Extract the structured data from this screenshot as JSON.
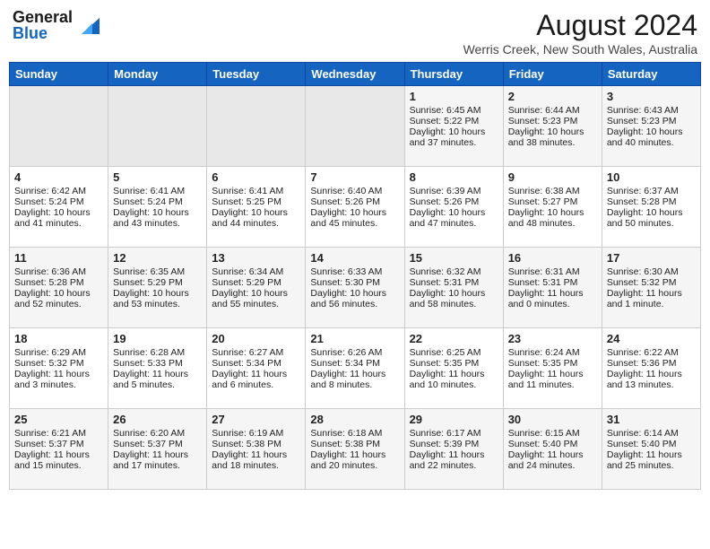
{
  "header": {
    "logo_general": "General",
    "logo_blue": "Blue",
    "month_title": "August 2024",
    "location": "Werris Creek, New South Wales, Australia"
  },
  "days_of_week": [
    "Sunday",
    "Monday",
    "Tuesday",
    "Wednesday",
    "Thursday",
    "Friday",
    "Saturday"
  ],
  "weeks": [
    [
      {
        "day": "",
        "empty": true
      },
      {
        "day": "",
        "empty": true
      },
      {
        "day": "",
        "empty": true
      },
      {
        "day": "",
        "empty": true
      },
      {
        "day": "1",
        "line1": "Sunrise: 6:45 AM",
        "line2": "Sunset: 5:22 PM",
        "line3": "Daylight: 10 hours",
        "line4": "and 37 minutes."
      },
      {
        "day": "2",
        "line1": "Sunrise: 6:44 AM",
        "line2": "Sunset: 5:23 PM",
        "line3": "Daylight: 10 hours",
        "line4": "and 38 minutes."
      },
      {
        "day": "3",
        "line1": "Sunrise: 6:43 AM",
        "line2": "Sunset: 5:23 PM",
        "line3": "Daylight: 10 hours",
        "line4": "and 40 minutes."
      }
    ],
    [
      {
        "day": "4",
        "line1": "Sunrise: 6:42 AM",
        "line2": "Sunset: 5:24 PM",
        "line3": "Daylight: 10 hours",
        "line4": "and 41 minutes."
      },
      {
        "day": "5",
        "line1": "Sunrise: 6:41 AM",
        "line2": "Sunset: 5:24 PM",
        "line3": "Daylight: 10 hours",
        "line4": "and 43 minutes."
      },
      {
        "day": "6",
        "line1": "Sunrise: 6:41 AM",
        "line2": "Sunset: 5:25 PM",
        "line3": "Daylight: 10 hours",
        "line4": "and 44 minutes."
      },
      {
        "day": "7",
        "line1": "Sunrise: 6:40 AM",
        "line2": "Sunset: 5:26 PM",
        "line3": "Daylight: 10 hours",
        "line4": "and 45 minutes."
      },
      {
        "day": "8",
        "line1": "Sunrise: 6:39 AM",
        "line2": "Sunset: 5:26 PM",
        "line3": "Daylight: 10 hours",
        "line4": "and 47 minutes."
      },
      {
        "day": "9",
        "line1": "Sunrise: 6:38 AM",
        "line2": "Sunset: 5:27 PM",
        "line3": "Daylight: 10 hours",
        "line4": "and 48 minutes."
      },
      {
        "day": "10",
        "line1": "Sunrise: 6:37 AM",
        "line2": "Sunset: 5:28 PM",
        "line3": "Daylight: 10 hours",
        "line4": "and 50 minutes."
      }
    ],
    [
      {
        "day": "11",
        "line1": "Sunrise: 6:36 AM",
        "line2": "Sunset: 5:28 PM",
        "line3": "Daylight: 10 hours",
        "line4": "and 52 minutes."
      },
      {
        "day": "12",
        "line1": "Sunrise: 6:35 AM",
        "line2": "Sunset: 5:29 PM",
        "line3": "Daylight: 10 hours",
        "line4": "and 53 minutes."
      },
      {
        "day": "13",
        "line1": "Sunrise: 6:34 AM",
        "line2": "Sunset: 5:29 PM",
        "line3": "Daylight: 10 hours",
        "line4": "and 55 minutes."
      },
      {
        "day": "14",
        "line1": "Sunrise: 6:33 AM",
        "line2": "Sunset: 5:30 PM",
        "line3": "Daylight: 10 hours",
        "line4": "and 56 minutes."
      },
      {
        "day": "15",
        "line1": "Sunrise: 6:32 AM",
        "line2": "Sunset: 5:31 PM",
        "line3": "Daylight: 10 hours",
        "line4": "and 58 minutes."
      },
      {
        "day": "16",
        "line1": "Sunrise: 6:31 AM",
        "line2": "Sunset: 5:31 PM",
        "line3": "Daylight: 11 hours",
        "line4": "and 0 minutes."
      },
      {
        "day": "17",
        "line1": "Sunrise: 6:30 AM",
        "line2": "Sunset: 5:32 PM",
        "line3": "Daylight: 11 hours",
        "line4": "and 1 minute."
      }
    ],
    [
      {
        "day": "18",
        "line1": "Sunrise: 6:29 AM",
        "line2": "Sunset: 5:32 PM",
        "line3": "Daylight: 11 hours",
        "line4": "and 3 minutes."
      },
      {
        "day": "19",
        "line1": "Sunrise: 6:28 AM",
        "line2": "Sunset: 5:33 PM",
        "line3": "Daylight: 11 hours",
        "line4": "and 5 minutes."
      },
      {
        "day": "20",
        "line1": "Sunrise: 6:27 AM",
        "line2": "Sunset: 5:34 PM",
        "line3": "Daylight: 11 hours",
        "line4": "and 6 minutes."
      },
      {
        "day": "21",
        "line1": "Sunrise: 6:26 AM",
        "line2": "Sunset: 5:34 PM",
        "line3": "Daylight: 11 hours",
        "line4": "and 8 minutes."
      },
      {
        "day": "22",
        "line1": "Sunrise: 6:25 AM",
        "line2": "Sunset: 5:35 PM",
        "line3": "Daylight: 11 hours",
        "line4": "and 10 minutes."
      },
      {
        "day": "23",
        "line1": "Sunrise: 6:24 AM",
        "line2": "Sunset: 5:35 PM",
        "line3": "Daylight: 11 hours",
        "line4": "and 11 minutes."
      },
      {
        "day": "24",
        "line1": "Sunrise: 6:22 AM",
        "line2": "Sunset: 5:36 PM",
        "line3": "Daylight: 11 hours",
        "line4": "and 13 minutes."
      }
    ],
    [
      {
        "day": "25",
        "line1": "Sunrise: 6:21 AM",
        "line2": "Sunset: 5:37 PM",
        "line3": "Daylight: 11 hours",
        "line4": "and 15 minutes."
      },
      {
        "day": "26",
        "line1": "Sunrise: 6:20 AM",
        "line2": "Sunset: 5:37 PM",
        "line3": "Daylight: 11 hours",
        "line4": "and 17 minutes."
      },
      {
        "day": "27",
        "line1": "Sunrise: 6:19 AM",
        "line2": "Sunset: 5:38 PM",
        "line3": "Daylight: 11 hours",
        "line4": "and 18 minutes."
      },
      {
        "day": "28",
        "line1": "Sunrise: 6:18 AM",
        "line2": "Sunset: 5:38 PM",
        "line3": "Daylight: 11 hours",
        "line4": "and 20 minutes."
      },
      {
        "day": "29",
        "line1": "Sunrise: 6:17 AM",
        "line2": "Sunset: 5:39 PM",
        "line3": "Daylight: 11 hours",
        "line4": "and 22 minutes."
      },
      {
        "day": "30",
        "line1": "Sunrise: 6:15 AM",
        "line2": "Sunset: 5:40 PM",
        "line3": "Daylight: 11 hours",
        "line4": "and 24 minutes."
      },
      {
        "day": "31",
        "line1": "Sunrise: 6:14 AM",
        "line2": "Sunset: 5:40 PM",
        "line3": "Daylight: 11 hours",
        "line4": "and 25 minutes."
      }
    ]
  ]
}
